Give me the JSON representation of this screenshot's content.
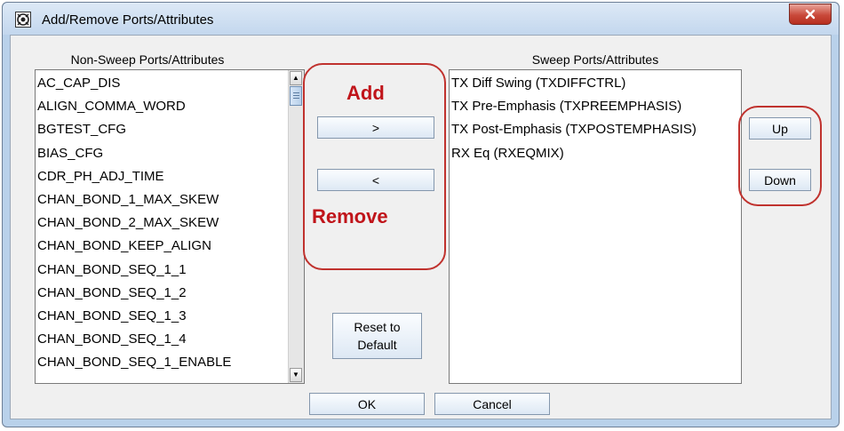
{
  "window": {
    "title": "Add/Remove Ports/Attributes",
    "close_glyph": "x"
  },
  "non_sweep": {
    "caption": "Non-Sweep Ports/Attributes",
    "items": [
      "AC_CAP_DIS",
      "ALIGN_COMMA_WORD",
      "BGTEST_CFG",
      "BIAS_CFG",
      "CDR_PH_ADJ_TIME",
      "CHAN_BOND_1_MAX_SKEW",
      "CHAN_BOND_2_MAX_SKEW",
      "CHAN_BOND_KEEP_ALIGN",
      "CHAN_BOND_SEQ_1_1",
      "CHAN_BOND_SEQ_1_2",
      "CHAN_BOND_SEQ_1_3",
      "CHAN_BOND_SEQ_1_4",
      "CHAN_BOND_SEQ_1_ENABLE"
    ]
  },
  "sweep": {
    "caption": "Sweep Ports/Attributes",
    "items": [
      "TX Diff Swing (TXDIFFCTRL)",
      "TX Pre-Emphasis (TXPREEMPHASIS)",
      "TX Post-Emphasis (TXPOSTEMPHASIS)",
      "RX Eq (RXEQMIX)"
    ]
  },
  "buttons": {
    "add": ">",
    "remove": "<",
    "reset_line1": "Reset to",
    "reset_line2": "Default",
    "up": "Up",
    "down": "Down",
    "ok": "OK",
    "cancel": "Cancel"
  },
  "annotations": {
    "add_label": "Add",
    "remove_label": "Remove",
    "color": "#c0322e"
  },
  "icons": {
    "app": "app-logo-icon",
    "close": "close-icon",
    "scroll_up": "scroll-up-arrow-icon",
    "scroll_down": "scroll-down-arrow-icon"
  }
}
